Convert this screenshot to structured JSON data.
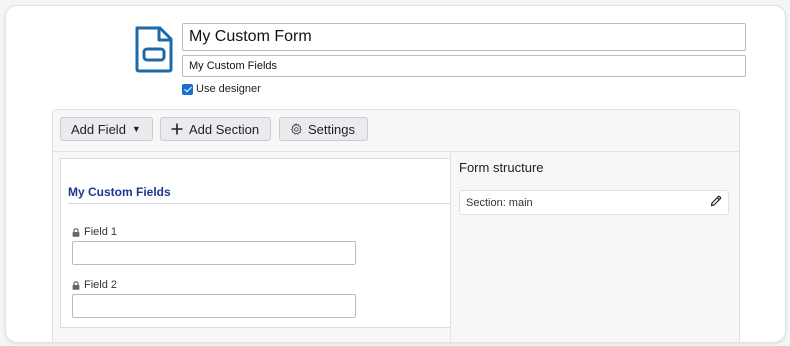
{
  "header": {
    "icon": "document-icon",
    "form_title": "My Custom Form",
    "form_subtitle": "My Custom Fields",
    "use_designer_label": "Use designer",
    "use_designer_checked": true
  },
  "toolbar": {
    "add_field_label": "Add Field",
    "add_field_caret": "▼",
    "add_section_label": "Add Section",
    "settings_label": "Settings"
  },
  "canvas": {
    "section_title": "My Custom Fields",
    "fields": [
      {
        "label": "Field 1",
        "value": ""
      },
      {
        "label": "Field 2",
        "value": ""
      }
    ]
  },
  "structure": {
    "title": "Form structure",
    "items": [
      {
        "label": "Section: main"
      }
    ]
  },
  "colors": {
    "accent": "#1a6fd6",
    "icon_blue": "#1e6aa8",
    "section_title": "#21358f"
  }
}
